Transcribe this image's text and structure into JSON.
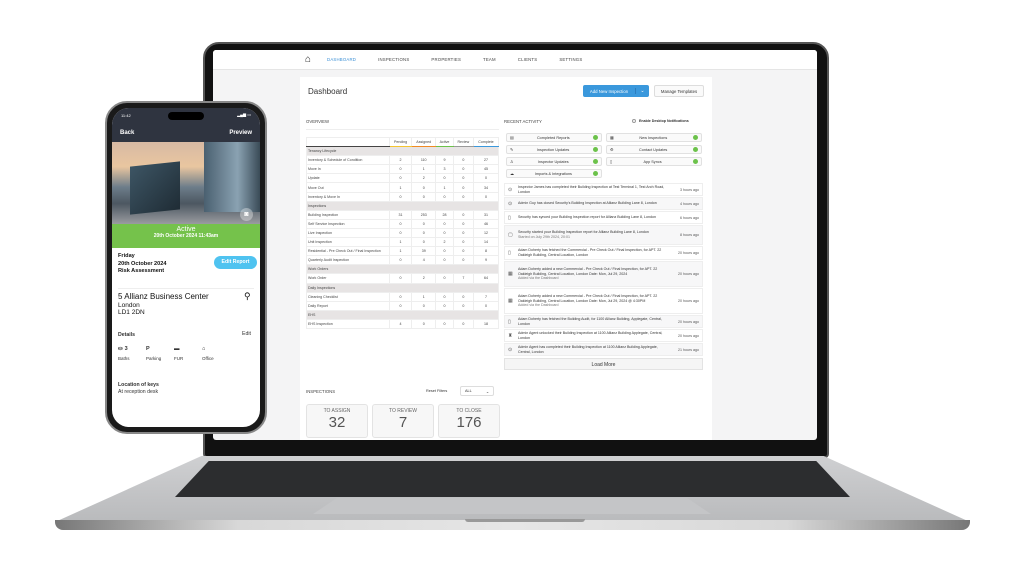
{
  "nav": {
    "items": [
      "DASHBOARD",
      "INSPECTIONS",
      "PROPERTIES",
      "TEAM",
      "CLIENTS",
      "SETTINGS"
    ],
    "active": "DASHBOARD"
  },
  "dashboard": {
    "title": "Dashboard",
    "add_button": "Add New Inspection",
    "manage_button": "Manage Templates",
    "overview_label": "OVERVIEW",
    "columns": [
      "Pending",
      "Assigned",
      "Active",
      "Review",
      "Complete"
    ],
    "column_colors": [
      "#f4c430",
      "#f08a24",
      "#6cc24a",
      "#999999",
      "#3a98dc"
    ],
    "groups": [
      {
        "name": "Tenancy Lifecycle",
        "rows": [
          [
            "Inventory & Schedule of Condition",
            "2",
            "110",
            "9",
            "0",
            "27"
          ],
          [
            "Move In",
            "0",
            "1",
            "3",
            "0",
            "45"
          ],
          [
            "Update",
            "0",
            "2",
            "0",
            "0",
            "0"
          ],
          [
            "Move Out",
            "1",
            "0",
            "1",
            "0",
            "34"
          ],
          [
            "Inventory & Move In",
            "0",
            "0",
            "0",
            "0",
            "0"
          ]
        ]
      },
      {
        "name": "Inspections",
        "rows": [
          [
            "Building Inspection",
            "31",
            "253",
            "28",
            "0",
            "31"
          ],
          [
            "Self Service Inspection",
            "0",
            "0",
            "0",
            "0",
            "46"
          ],
          [
            "Live Inspection",
            "0",
            "0",
            "0",
            "0",
            "12"
          ],
          [
            "Unit Inspection",
            "1",
            "0",
            "2",
            "0",
            "14"
          ],
          [
            "Residential - Pre Check Out / Final Inspection",
            "1",
            "39",
            "0",
            "0",
            "8"
          ],
          [
            "Quarterly Audit Inspection",
            "0",
            "4",
            "0",
            "0",
            "9"
          ]
        ]
      },
      {
        "name": "Work Orders",
        "rows": [
          [
            "Work Order",
            "0",
            "2",
            "0",
            "7",
            "64"
          ]
        ]
      },
      {
        "name": "Daily Inspections",
        "rows": [
          [
            "Cleaning Checklist",
            "0",
            "1",
            "0",
            "0",
            "7"
          ],
          [
            "Daily Report",
            "0",
            "0",
            "0",
            "0",
            "0"
          ]
        ]
      },
      {
        "name": "EHS",
        "rows": [
          [
            "EHS Inspection",
            "4",
            "0",
            "0",
            "0",
            "18"
          ]
        ]
      }
    ],
    "inspections_label": "INSPECTIONS",
    "reset_filters": "Reset Filters",
    "filter_value": "ALL",
    "counters": [
      {
        "label": "TO ASSIGN",
        "value": "32"
      },
      {
        "label": "TO REVIEW",
        "value": "7"
      },
      {
        "label": "TO CLOSE",
        "value": "176"
      }
    ],
    "recent_label": "RECENT ACTIVITY",
    "desktop_notif": "Enable Desktop Notifications",
    "chips": [
      {
        "icon": "report-icon",
        "label": "Completed Reports"
      },
      {
        "icon": "calendar-icon",
        "label": "New Inspections"
      },
      {
        "icon": "edit-icon",
        "label": "Inspection Updates"
      },
      {
        "icon": "gear-icon",
        "label": "Contact Updates"
      },
      {
        "icon": "user-icon",
        "label": "Inspector Updates"
      },
      {
        "icon": "phone-icon",
        "label": "App Syncs"
      },
      {
        "icon": "cloud-icon",
        "label": "Imports & Integrations"
      }
    ],
    "activity": [
      {
        "icon": "check-circle-icon",
        "text": "Inspector James has completed their Building Inspection at Test Terminal 1, Test Arch Road, London",
        "sub": "",
        "time": "3 hours ago"
      },
      {
        "icon": "check-circle-icon",
        "text": "Admin Guy has closed Security's Building Inspection at Allianz Building Lane 8, London",
        "sub": "",
        "time": "4 hours ago"
      },
      {
        "icon": "phone-icon",
        "text": "Security has synced your Building Inspection report for Allianz Building Lane 8, London",
        "sub": "",
        "time": "6 hours ago"
      },
      {
        "icon": "tablet-icon",
        "text": "Security started your Building Inspection report for Allianz Building Lane 8, London",
        "sub": "Started on July 29th 2024, 20:01",
        "time": "8 hours ago"
      },
      {
        "icon": "phone-icon",
        "text": "Adam Doherty has fetched the Commercial - Pre Check Out / Final Inspection, for APT. 22 Oakleigh Building, Central Location, London",
        "sub": "",
        "time": "20 hours ago"
      },
      {
        "icon": "calendar-icon",
        "text": "Adam Doherty added a new Commercial - Pre Check Out / Final Inspection, for APT. 22 Oakleigh Building, Central Location, London Date: Mon, Jul 29, 2024",
        "sub": "Added via the Dashboard",
        "time": "20 hours ago"
      },
      {
        "icon": "calendar-icon",
        "text": "Adam Doherty added a new Commercial - Pre Check Out / Final Inspection, for APT. 22 Oakleigh Building, Central Location, London Date: Mon, Jul 29, 2024 @ 4:30PM",
        "sub": "Added via the Dashboard",
        "time": "20 hours ago"
      },
      {
        "icon": "phone-icon",
        "text": "Adam Doherty has fetched the Building Audit, for 1100 Allianz Building, Applegate, Central, London",
        "sub": "",
        "time": "20 hours ago"
      },
      {
        "icon": "lock-icon",
        "text": "Admin Agent unlocked their Building Inspection at 1100 Allianz Building Applegate, Central, London",
        "sub": "",
        "time": "20 hours ago"
      },
      {
        "icon": "check-circle-icon",
        "text": "Admin Agent has completed their Building Inspection at 1100 Allianz Building Applegate, Central, London",
        "sub": "",
        "time": "21 hours ago"
      }
    ],
    "load_more": "Load More"
  },
  "phone": {
    "time": "11:42",
    "back": "Back",
    "preview": "Preview",
    "status": "Active",
    "status_date": "20th October 2024 11:43am",
    "day": "Friday",
    "date": "20th October 2024",
    "type": "Risk Assessment",
    "edit_report": "Edit Report",
    "address_line1": "5 Allianz Business Center",
    "address_line2": "London",
    "address_line3": "LD1 2DN",
    "details_label": "Details",
    "edit": "Edit",
    "details": [
      {
        "icon": "bath-icon",
        "value": "3",
        "label": "Baths"
      },
      {
        "icon": "parking-icon",
        "value": "P",
        "label": "Parking"
      },
      {
        "icon": "sofa-icon",
        "value": "",
        "label": "FUR"
      },
      {
        "icon": "home-icon",
        "value": "",
        "label": "Office"
      }
    ],
    "keys_label": "Location of keys",
    "keys_value": "At reception desk",
    "colors": {
      "status": "#75c24b",
      "edit_button": "#4fc3f0",
      "header": "#2f3440"
    }
  }
}
